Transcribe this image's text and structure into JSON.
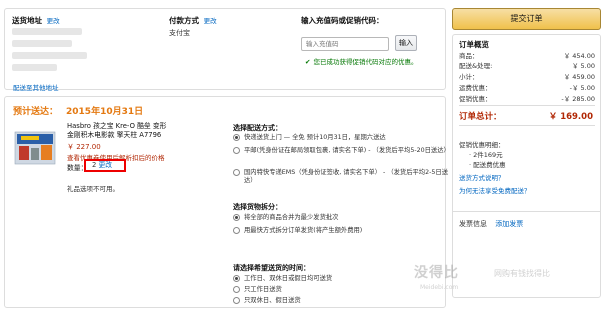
{
  "address": {
    "title": "送货地址",
    "change": "更改",
    "link": "配送至其他地址"
  },
  "payment": {
    "title": "付款方式",
    "change": "更改",
    "method": "支付宝"
  },
  "promo": {
    "title": "输入充值码或促销代码：",
    "placeholder": "输入充值码",
    "button": "输入",
    "hint": "您已成功获得促销代码对应的优惠。"
  },
  "shipment": {
    "label": "预计送达：",
    "date": "2015年10月31日",
    "product": {
      "title": "Hasbro 孩之宝 Kre-O 酷垒 变形金刚积木电影款 擎天柱 A7796",
      "price": "￥ 227.00",
      "note": "查看优惠券使用后解析扣后的价格",
      "qty_label": "数量：",
      "qty_value": "2",
      "qty_change": "更改",
      "gift": "礼品选项不可用。"
    },
    "delivery_options": {
      "title": "选择配送方式：",
      "options": [
        {
          "label": "快递送货上门 — 全免 预计10月31日，星期六送达",
          "sub": "",
          "selected": true
        },
        {
          "label": "平邮(凭身份证在邮局领取包裹, 请实名下单) - （发货后平均5-20日送达）",
          "sub": "",
          "selected": false
        },
        {
          "label": "国内特快专递EMS（凭身份证签收, 请实名下单） - （发货后平均2-5日送达）",
          "sub": "",
          "selected": false
        }
      ]
    },
    "split_options": {
      "title": "选择货物拆分：",
      "options": [
        {
          "label": "将全部的商品合并为最少发货批次",
          "sub": "",
          "selected": true
        },
        {
          "label": "用最快方式拆分订单发货(将产生额外费用)",
          "sub": "(将产生额外费用)",
          "selected": false
        }
      ]
    },
    "time_options": {
      "title": "请选择希望送货的时间：",
      "options": [
        {
          "label": "工作日、双休日或假日均可送货",
          "selected": true
        },
        {
          "label": "只工作日送货",
          "selected": false
        },
        {
          "label": "只双休日、假日送货",
          "selected": false
        }
      ]
    }
  },
  "summary": {
    "place_order": "提交订单",
    "title": "订单概览",
    "rows": [
      {
        "label": "商品：",
        "value": "￥ 454.00"
      },
      {
        "label": "配送&处理:",
        "value": "￥ 5.00"
      },
      {
        "label": "小计：",
        "value": "￥ 459.00"
      },
      {
        "label": "运费优惠：",
        "value": "-￥ 5.00"
      },
      {
        "label": "促销优惠：",
        "value": "-￥ 285.00"
      }
    ],
    "total_label": "订单总计：",
    "total_value": "￥ 169.00",
    "promos_title": "促销优惠明细：",
    "promos": [
      "2件169元",
      "配送费优惠"
    ],
    "link1": "送货方式说明？",
    "link2": "为何无法享受免费配送？",
    "invoice_label": "发票信息",
    "invoice_link": "添加发票"
  },
  "watermark": {
    "main": "没得比",
    "sub": "Meidebi.com",
    "side": "网购有钱找得比"
  }
}
